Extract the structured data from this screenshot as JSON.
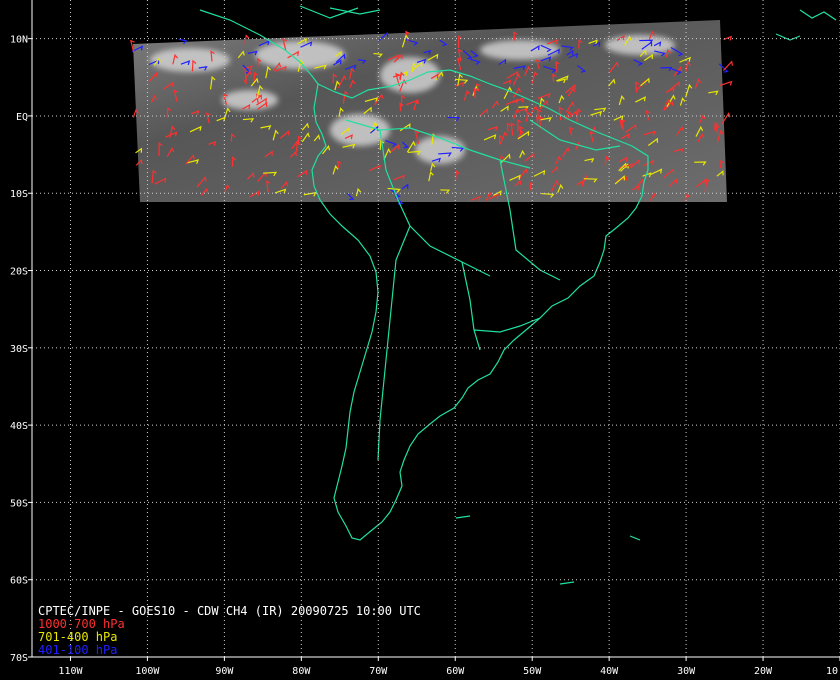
{
  "product_title": "CPTEC/INPE - GOES10 - CDW CH4 (IR) 20090725 10:00 UTC",
  "legend": [
    {
      "label": "1000-700 hPa",
      "color": "#ff3030"
    },
    {
      "label": "701-400 hPa",
      "color": "#e8e800"
    },
    {
      "label": "401-100 hPa",
      "color": "#2020ff"
    }
  ],
  "map": {
    "lon_range": [
      -115,
      -10
    ],
    "lat_range": [
      -70,
      15
    ],
    "lat_ticks": [
      {
        "value": 10,
        "label": "10N"
      },
      {
        "value": 0,
        "label": "EQ"
      },
      {
        "value": -10,
        "label": "10S"
      },
      {
        "value": -20,
        "label": "20S"
      },
      {
        "value": -30,
        "label": "30S"
      },
      {
        "value": -40,
        "label": "40S"
      },
      {
        "value": -50,
        "label": "50S"
      },
      {
        "value": -60,
        "label": "60S"
      },
      {
        "value": -70,
        "label": "70S"
      }
    ],
    "lon_ticks": [
      {
        "value": -110,
        "label": "110W"
      },
      {
        "value": -100,
        "label": "100W"
      },
      {
        "value": -90,
        "label": "90W"
      },
      {
        "value": -80,
        "label": "80W"
      },
      {
        "value": -70,
        "label": "70W"
      },
      {
        "value": -60,
        "label": "60W"
      },
      {
        "value": -50,
        "label": "50W"
      },
      {
        "value": -40,
        "label": "40W"
      },
      {
        "value": -30,
        "label": "30W"
      },
      {
        "value": -20,
        "label": "20W"
      },
      {
        "value": -10,
        "label": "10"
      }
    ],
    "grid": true,
    "coastline_color": "#20e0a0",
    "imagery_extent": {
      "lon": [
        -102,
        -24
      ],
      "lat": [
        -11,
        10
      ]
    }
  }
}
